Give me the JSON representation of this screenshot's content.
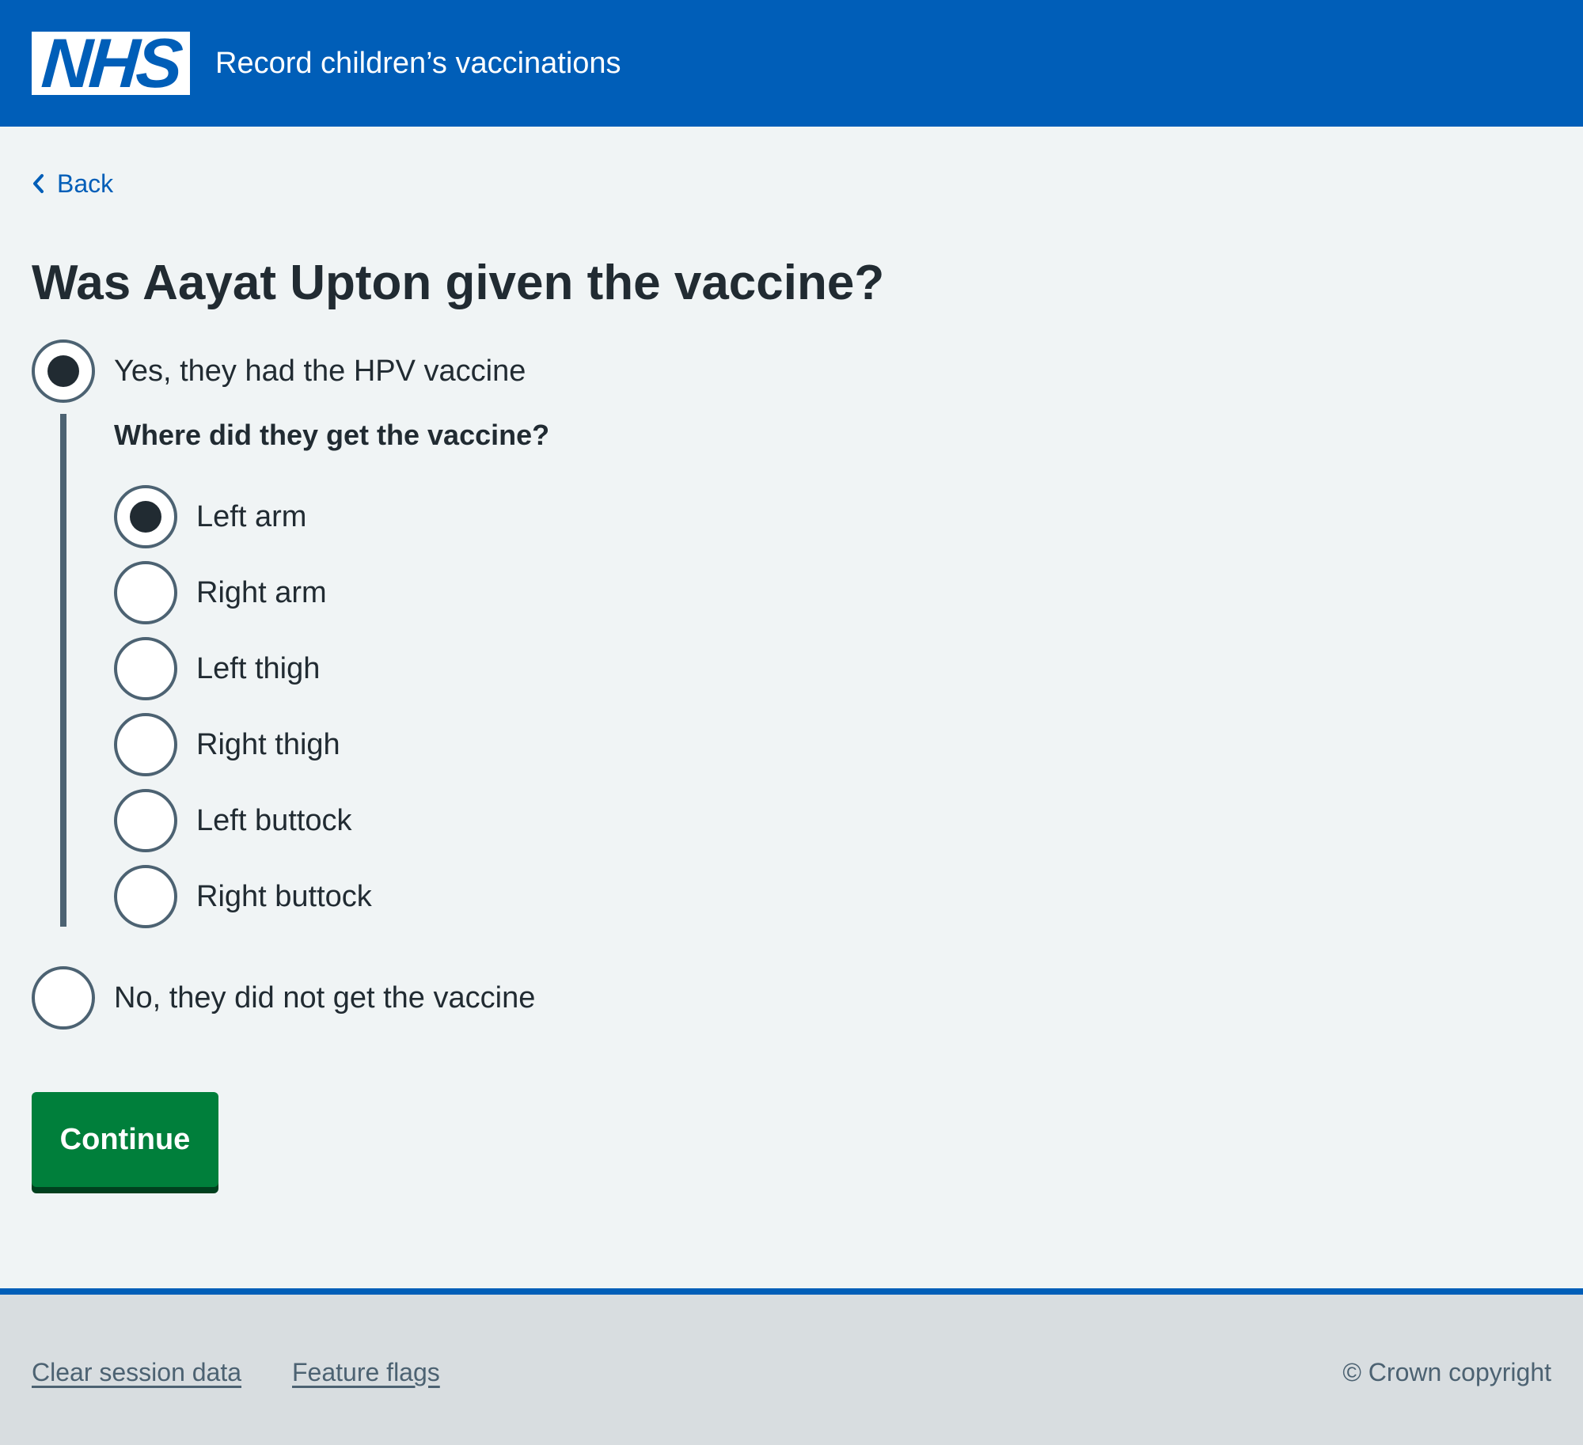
{
  "header": {
    "logo_text": "NHS",
    "service_name": "Record children’s vaccinations",
    "brand_color": "#005eb8"
  },
  "back_link": {
    "label": "Back",
    "icon": "chevron-left-icon"
  },
  "page": {
    "title": "Was Aayat Upton given the vaccine?"
  },
  "question": {
    "options": [
      {
        "label": "Yes, they had the HPV vaccine",
        "checked": true
      },
      {
        "label": "No, they did not get the vaccine",
        "checked": false
      }
    ],
    "conditional": {
      "question": "Where did they get the vaccine?",
      "options": [
        {
          "label": "Left arm",
          "checked": true
        },
        {
          "label": "Right arm",
          "checked": false
        },
        {
          "label": "Left thigh",
          "checked": false
        },
        {
          "label": "Right thigh",
          "checked": false
        },
        {
          "label": "Left buttock",
          "checked": false
        },
        {
          "label": "Right buttock",
          "checked": false
        }
      ]
    }
  },
  "actions": {
    "continue_label": "Continue",
    "continue_color": "#007f3b"
  },
  "footer": {
    "links": [
      "Clear session data",
      "Feature flags"
    ],
    "copyright": "© Crown copyright"
  }
}
